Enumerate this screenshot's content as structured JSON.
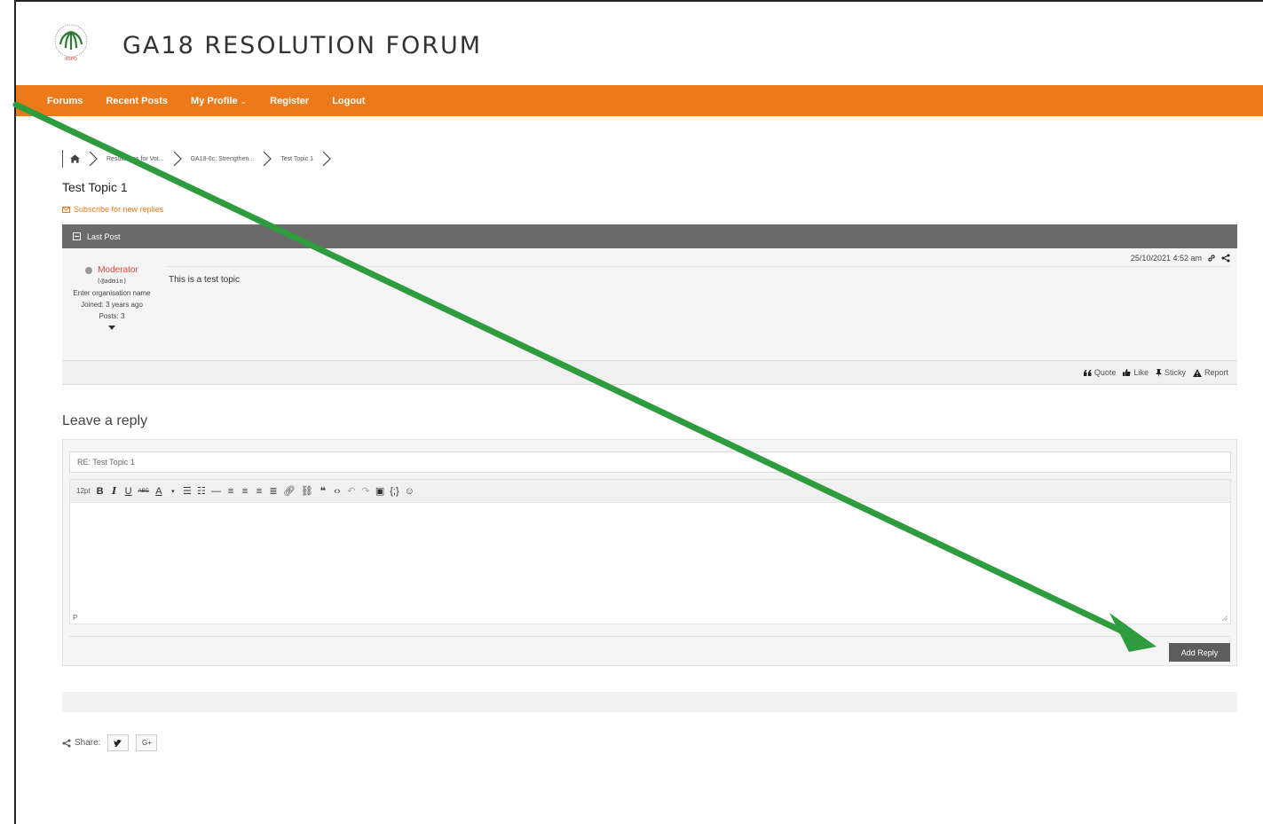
{
  "site": {
    "title": "GA18 RESOLUTION FORUM",
    "logo_icon": "rspo-palm-logo-icon"
  },
  "nav": {
    "items": [
      {
        "label": "Forums"
      },
      {
        "label": "Recent Posts"
      },
      {
        "label": "My Profile",
        "caret": "⌄"
      },
      {
        "label": "Register"
      },
      {
        "label": "Logout"
      }
    ],
    "color": "#ec7a1b"
  },
  "breadcrumb": {
    "items": [
      "Resolutions for Vot...",
      "GA18-6c: Strengthen...",
      "Test Topic 1"
    ]
  },
  "topic": {
    "title": "Test Topic 1",
    "subscribe": "Subscribe for new replies"
  },
  "post": {
    "header": "Last Post",
    "date": "25/10/2021 4:52 am",
    "author": {
      "name": "Moderator",
      "handle": "(@admin)",
      "org": "Enter organisation name",
      "joined": "Joined: 3 years ago",
      "posts": "Posts: 3"
    },
    "content": "This is a test topic",
    "actions": [
      "Quote",
      "Like",
      "Sticky",
      "Report"
    ]
  },
  "reply": {
    "title": "Leave a reply",
    "subject_value": "RE: Test Topic 1",
    "font_size": "12pt",
    "editor_status": "P",
    "submit": "Add Reply"
  },
  "share": {
    "label": "Share:"
  },
  "annotation": {
    "arrow_color": "#2e9b3f"
  }
}
